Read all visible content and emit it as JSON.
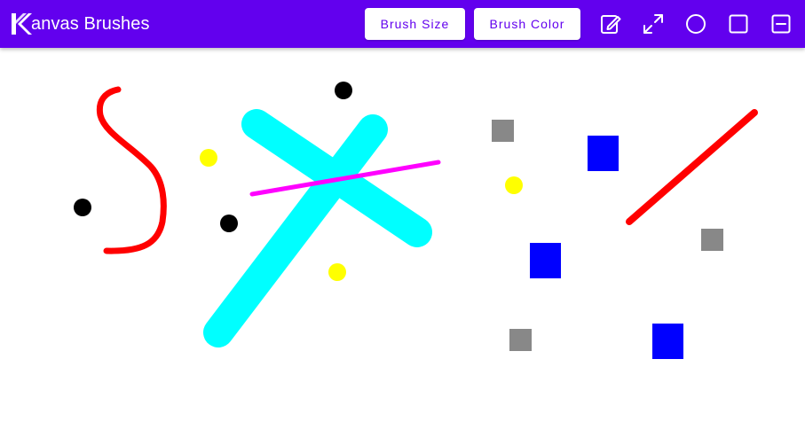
{
  "app": {
    "title": "anvas Brushes"
  },
  "toolbar": {
    "brush_size_label": "Brush Size",
    "brush_color_label": "Brush Color",
    "tools": [
      {
        "name": "pencil-edit-icon"
      },
      {
        "name": "expand-arrows-icon"
      },
      {
        "name": "circle-shape-icon"
      },
      {
        "name": "square-shape-icon"
      },
      {
        "name": "minus-box-icon"
      }
    ]
  },
  "colors": {
    "appbar": "#6200ee",
    "button_text": "#6200ee",
    "red": "#ff0000",
    "cyan": "#00ffff",
    "magenta": "#ff00ff",
    "black": "#000000",
    "yellow": "#ffff00",
    "gray": "#888888",
    "blue": "#0000ff"
  },
  "canvas": {
    "strokes": [
      {
        "name": "red-curve-stroke",
        "color": "red"
      },
      {
        "name": "cyan-thick-stroke-1",
        "color": "cyan"
      },
      {
        "name": "cyan-thick-stroke-2",
        "color": "cyan"
      },
      {
        "name": "magenta-line-stroke",
        "color": "magenta"
      },
      {
        "name": "red-diagonal-stroke",
        "color": "red"
      }
    ],
    "dots": [
      {
        "color": "black"
      },
      {
        "color": "black"
      },
      {
        "color": "black"
      },
      {
        "color": "yellow"
      },
      {
        "color": "yellow"
      },
      {
        "color": "yellow"
      }
    ],
    "squares": [
      {
        "color": "gray"
      },
      {
        "color": "gray"
      },
      {
        "color": "gray"
      },
      {
        "color": "blue"
      },
      {
        "color": "blue"
      },
      {
        "color": "blue"
      }
    ]
  }
}
